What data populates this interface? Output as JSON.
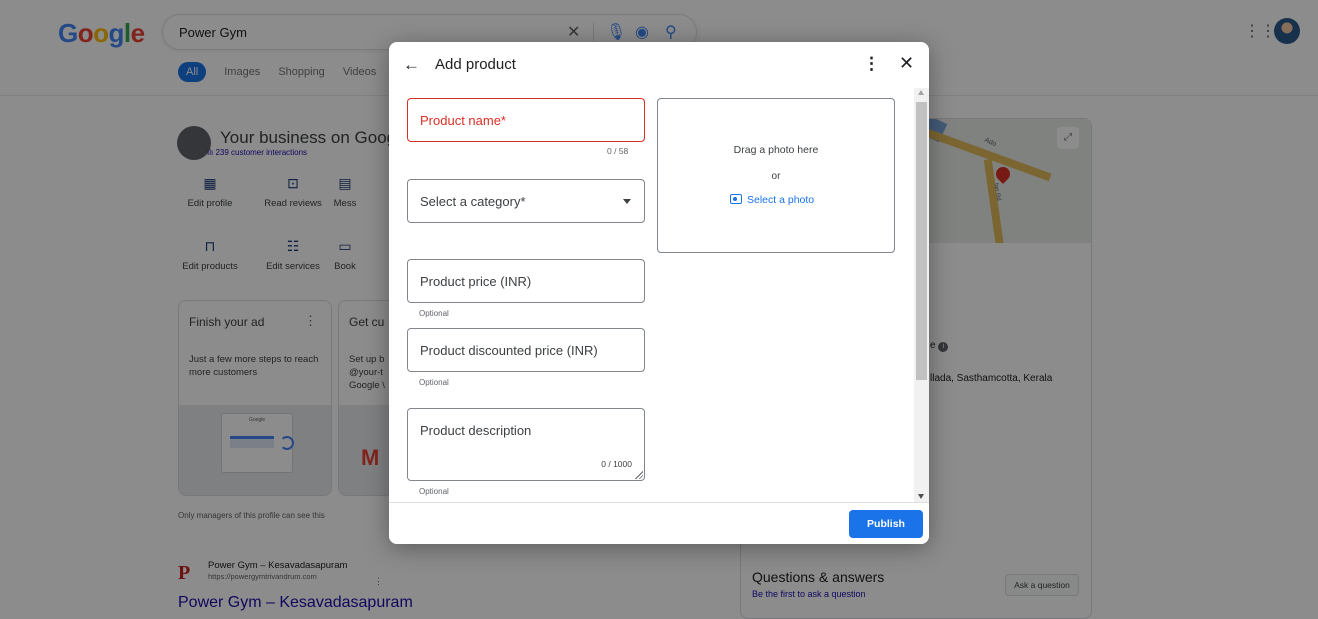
{
  "search": {
    "query": "Power Gym",
    "tabs": [
      "All",
      "Images",
      "Shopping",
      "Videos"
    ]
  },
  "business": {
    "title": "Your business on Google",
    "interactions": "239 customer interactions",
    "actions": [
      {
        "label": "Edit profile",
        "icon": "storefront-icon"
      },
      {
        "label": "Read reviews",
        "icon": "star-comment-icon"
      },
      {
        "label": "Mess",
        "icon": "message-icon"
      },
      {
        "label": "Edit products",
        "icon": "shopping-bag-icon"
      },
      {
        "label": "Edit services",
        "icon": "list-icon"
      },
      {
        "label": "Book",
        "icon": "calendar-icon"
      }
    ],
    "cards": [
      {
        "title": "Finish your ad",
        "text": "Just a few more steps to reach more customers"
      },
      {
        "title": "Get cu",
        "text": "Set up b @your-t Google \\"
      }
    ],
    "mini_logo": "Google",
    "managers_note": "Only managers of this profile can see this"
  },
  "result": {
    "favicon": "P",
    "site_name": "Power Gym – Kesavadasapuram",
    "url": "https://powergymtrivandrum.com",
    "more": "⋮",
    "link": "Power Gym – Kesavadasapuram"
  },
  "right_panel": {
    "map_label1": "Ado",
    "map_label2": "fan Rd",
    "partial_text": "e",
    "address_fragment": "llada, Sasthamcotta, Kerala",
    "qa_title": "Questions & answers",
    "qa_sub": "Be the first to ask a question",
    "ask_button": "Ask a question"
  },
  "dialog": {
    "title": "Add product",
    "fields": {
      "product_name": {
        "placeholder": "Product name*",
        "counter": "0 / 58"
      },
      "category": {
        "placeholder": "Select a category*"
      },
      "price": {
        "placeholder": "Product price (INR)",
        "helper": "Optional"
      },
      "discounted_price": {
        "placeholder": "Product discounted price (INR)",
        "helper": "Optional"
      },
      "description": {
        "placeholder": "Product description",
        "counter": "0 / 1000",
        "helper": "Optional"
      }
    },
    "photo": {
      "drag_text": "Drag a photo here",
      "or_text": "or",
      "select_label": "Select a photo"
    },
    "publish_label": "Publish"
  },
  "colors": {
    "accent": "#1a73e8",
    "error": "#d93025",
    "scrim": "rgba(0,0,0,0.45)"
  }
}
